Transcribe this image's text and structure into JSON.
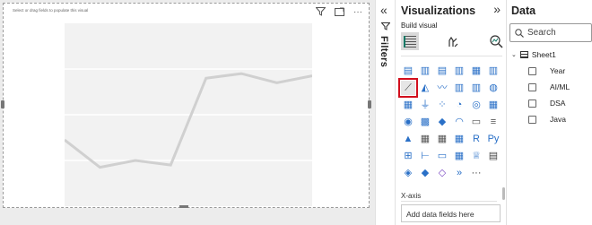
{
  "canvas": {
    "hint": "Select or drag fields to populate this visual",
    "tool_icons": [
      "filter-icon",
      "focus-mode-icon",
      "more-options-icon"
    ],
    "chart_data": {
      "type": "line",
      "x": [
        1,
        2,
        3,
        4,
        5,
        6,
        7,
        8
      ],
      "values": [
        29,
        17,
        20,
        18,
        56,
        58,
        54,
        57
      ],
      "ylim": [
        0,
        80
      ],
      "grid": true,
      "series_color": "#d0d0d0"
    }
  },
  "filters": {
    "label": "Filters",
    "collapse_icon": "double-chevron-left-icon"
  },
  "visualizations": {
    "title": "Visualizations",
    "expand_icon": "double-chevron-right-icon",
    "build_label": "Build visual",
    "build_icons": [
      "build-visual-icon",
      "format-visual-icon",
      "analytics-icon"
    ],
    "grid_rows": [
      [
        {
          "g": "▤",
          "c": "#2a70c7"
        },
        {
          "g": "▥",
          "c": "#2a70c7"
        },
        {
          "g": "▤",
          "c": "#2a70c7"
        },
        {
          "g": "▥",
          "c": "#2a70c7"
        },
        {
          "g": "▦",
          "c": "#2a70c7"
        },
        {
          "g": "▥",
          "c": "#2a70c7"
        }
      ],
      [
        {
          "g": "⟋",
          "c": "#444"
        },
        {
          "g": "◭",
          "c": "#2a70c7"
        },
        {
          "g": "〰",
          "c": "#2a70c7"
        },
        {
          "g": "▥",
          "c": "#2a70c7"
        },
        {
          "g": "▥",
          "c": "#2a70c7"
        },
        {
          "g": "◍",
          "c": "#2a70c7"
        }
      ],
      [
        {
          "g": "▦",
          "c": "#2a70c7"
        },
        {
          "g": "⏚",
          "c": "#2a70c7"
        },
        {
          "g": "⁘",
          "c": "#2a70c7"
        },
        {
          "g": "◔",
          "c": "#2a70c7"
        },
        {
          "g": "◎",
          "c": "#2a70c7"
        },
        {
          "g": "▦",
          "c": "#2a70c7"
        }
      ],
      [
        {
          "g": "◉",
          "c": "#2a70c7"
        },
        {
          "g": "▩",
          "c": "#2a70c7"
        },
        {
          "g": "◆",
          "c": "#2a70c7"
        },
        {
          "g": "◠",
          "c": "#2a70c7"
        },
        {
          "g": "▭",
          "c": "#555"
        },
        {
          "g": "≡",
          "c": "#555"
        }
      ],
      [
        {
          "g": "▲",
          "c": "#2a70c7"
        },
        {
          "g": "▦",
          "c": "#555"
        },
        {
          "g": "▦",
          "c": "#555"
        },
        {
          "g": "▦",
          "c": "#2a70c7"
        },
        {
          "g": "R",
          "c": "#2a70c7"
        },
        {
          "g": "Py",
          "c": "#2a70c7"
        }
      ],
      [
        {
          "g": "⊞",
          "c": "#2a70c7"
        },
        {
          "g": "⊢",
          "c": "#2a70c7"
        },
        {
          "g": "▭",
          "c": "#2a70c7"
        },
        {
          "g": "▦",
          "c": "#2a70c7"
        },
        {
          "g": "♕",
          "c": "#2a70c7"
        },
        {
          "g": "▤",
          "c": "#444"
        }
      ],
      [
        {
          "g": "◈",
          "c": "#2a70c7"
        },
        {
          "g": "◆",
          "c": "#2a70c7"
        },
        {
          "g": "◇",
          "c": "#7b4ac4"
        },
        {
          "g": "»",
          "c": "#2a70c7"
        },
        {
          "g": "···",
          "c": "#333"
        }
      ]
    ],
    "x_axis_label": "X-axis",
    "add_field_placeholder": "Add data fields here"
  },
  "data_pane": {
    "title": "Data",
    "search_placeholder": "Search",
    "table_name": "Sheet1",
    "fields": [
      "Year",
      "AI/ML",
      "DSA",
      "Java"
    ]
  }
}
